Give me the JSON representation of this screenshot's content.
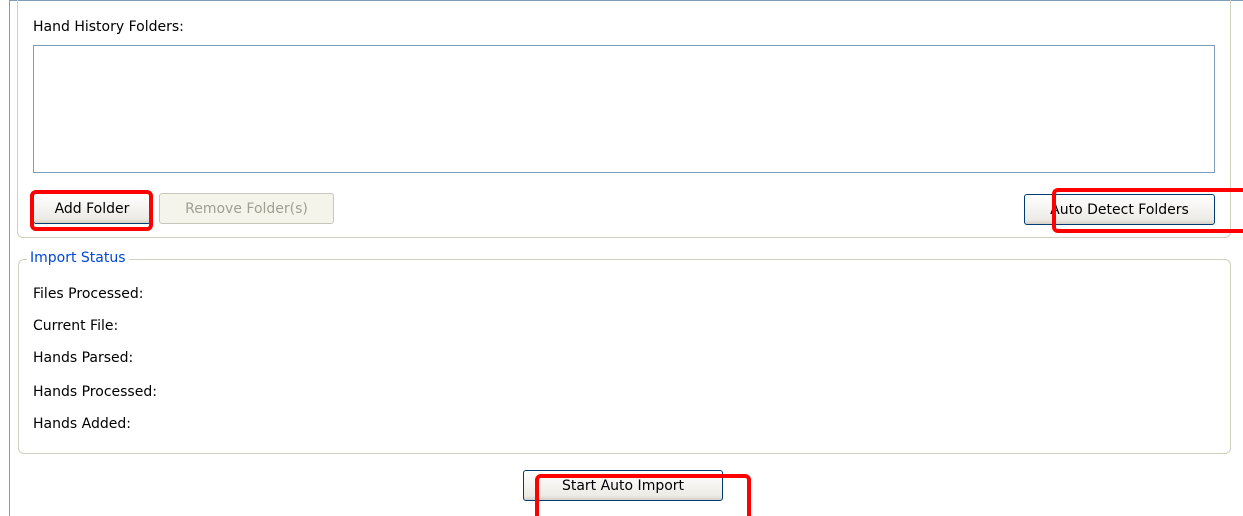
{
  "folders": {
    "label": "Hand History Folders:",
    "items": [],
    "add_label": "Add Folder",
    "remove_label": "Remove Folder(s)",
    "auto_detect_label": "Auto Detect Folders"
  },
  "import_status": {
    "legend": "Import Status",
    "fields": [
      {
        "label": "Files Processed:",
        "value": ""
      },
      {
        "label": "Current File:",
        "value": ""
      },
      {
        "label": "Hands Parsed:",
        "value": ""
      },
      {
        "label": "Hands Processed:",
        "value": ""
      },
      {
        "label": "Hands Added:",
        "value": ""
      }
    ]
  },
  "actions": {
    "start_label": "Start Auto Import"
  },
  "colors": {
    "highlight": "#ff0000",
    "legend_text": "#0046d5",
    "frame_border": "#7f9db9"
  }
}
